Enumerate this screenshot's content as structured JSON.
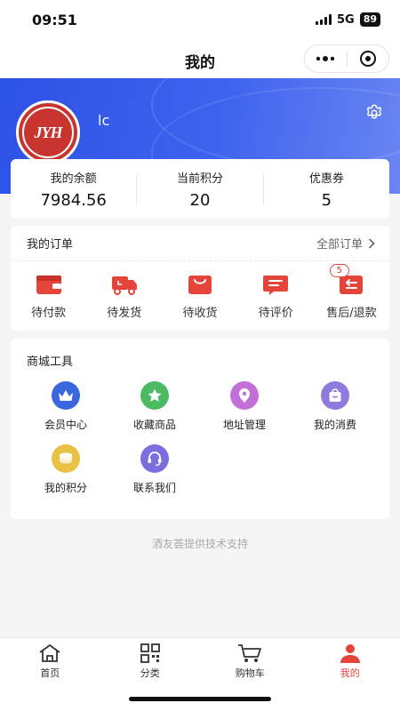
{
  "status_bar": {
    "time": "09:51",
    "network": "5G",
    "battery": "89"
  },
  "nav": {
    "title": "我的"
  },
  "profile": {
    "username": "lc",
    "avatar_text": "JYH"
  },
  "stats": [
    {
      "label": "我的余额",
      "value": "7984.56"
    },
    {
      "label": "当前积分",
      "value": "20"
    },
    {
      "label": "优惠券",
      "value": "5"
    }
  ],
  "orders": {
    "title": "我的订单",
    "all_label": "全部订单",
    "items": [
      {
        "label": "待付款",
        "icon": "wallet-icon"
      },
      {
        "label": "待发货",
        "icon": "truck-icon"
      },
      {
        "label": "待收货",
        "icon": "package-icon"
      },
      {
        "label": "待评价",
        "icon": "comment-icon"
      },
      {
        "label": "售后/退款",
        "icon": "return-icon",
        "badge": "5"
      }
    ]
  },
  "tools": {
    "title": "商城工具",
    "items": [
      {
        "label": "会员中心",
        "icon": "crown-icon",
        "color": "#3a66e0"
      },
      {
        "label": "收藏商品",
        "icon": "star-icon",
        "color": "#4cba63"
      },
      {
        "label": "地址管理",
        "icon": "location-icon",
        "color": "#c36fd8"
      },
      {
        "label": "我的消费",
        "icon": "bag-icon",
        "color": "#8f7be0"
      },
      {
        "label": "我的积分",
        "icon": "coins-icon",
        "color": "#e9c144"
      },
      {
        "label": "联系我们",
        "icon": "support-icon",
        "color": "#7b6fe0"
      }
    ]
  },
  "footer_note": "酒友荟提供技术支持",
  "tabbar": {
    "items": [
      {
        "label": "首页",
        "icon": "home-icon"
      },
      {
        "label": "分类",
        "icon": "grid-icon"
      },
      {
        "label": "购物车",
        "icon": "cart-icon"
      },
      {
        "label": "我的",
        "icon": "user-icon",
        "active": true
      }
    ]
  },
  "colors": {
    "accent": "#e5443b",
    "brand_blue": "#2c52e6"
  }
}
